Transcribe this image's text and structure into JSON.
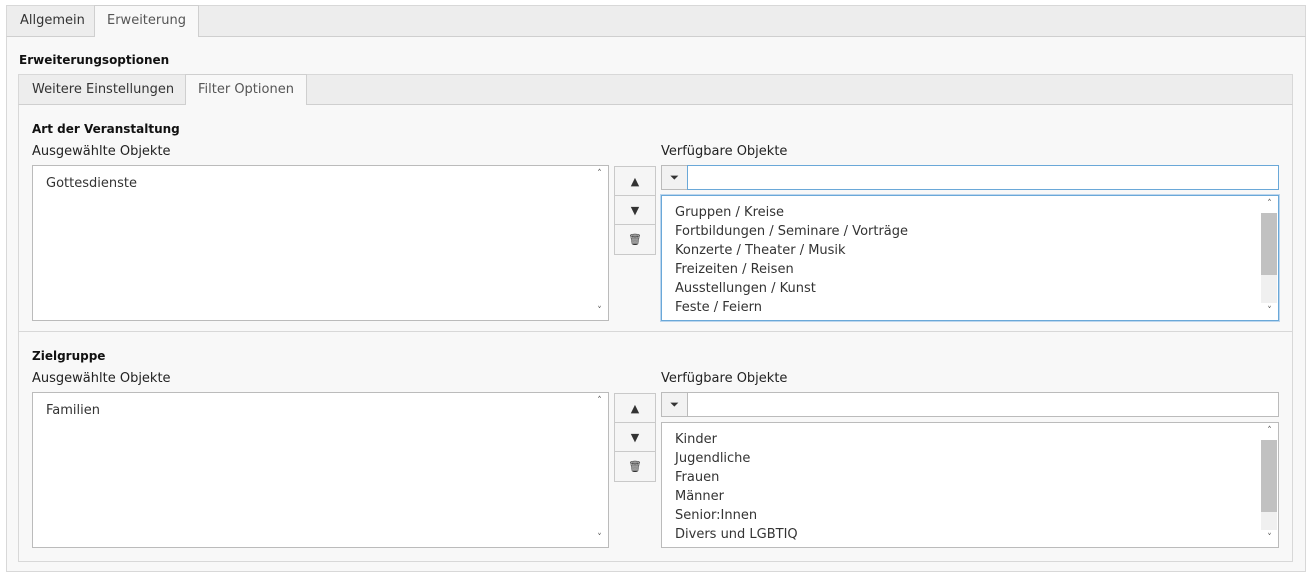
{
  "outer_tabs": [
    {
      "label": "Allgemein",
      "active": false
    },
    {
      "label": "Erweiterung",
      "active": true
    }
  ],
  "section_title": "Erweiterungsoptionen",
  "inner_tabs": [
    {
      "label": "Weitere Einstellungen",
      "active": false
    },
    {
      "label": "Filter Optionen",
      "active": true
    }
  ],
  "groups": [
    {
      "title": "Art der Veranstaltung",
      "selected_label": "Ausgewählte Objekte",
      "available_label": "Verfügbare Objekte",
      "selected_items": [
        "Gottesdienste"
      ],
      "filter_value": "",
      "available_items": [
        "Gruppen / Kreise",
        "Fortbildungen / Seminare / Vorträge",
        "Konzerte / Theater / Musik",
        "Freizeiten / Reisen",
        "Ausstellungen / Kunst",
        "Feste / Feiern"
      ]
    },
    {
      "title": "Zielgruppe",
      "selected_label": "Ausgewählte Objekte",
      "available_label": "Verfügbare Objekte",
      "selected_items": [
        "Familien"
      ],
      "filter_value": "",
      "available_items": [
        "Kinder",
        "Jugendliche",
        "Frauen",
        "Männer",
        "Senior:Innen",
        "Divers und LGBTIQ"
      ]
    }
  ],
  "icons": {
    "move_up": "▲",
    "move_down": "▼",
    "delete": "🗑",
    "filter": "⏷",
    "scroll_up": "˄",
    "scroll_down": "˅"
  }
}
